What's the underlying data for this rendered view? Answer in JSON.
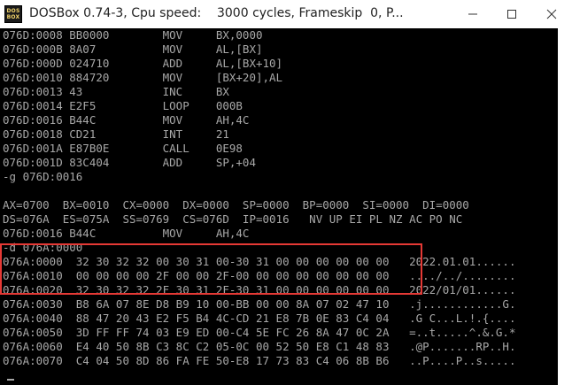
{
  "window": {
    "title": "DOSBox 0.74-3, Cpu speed:    3000 cycles, Frameskip  0, P...",
    "icon_line1": "DOS",
    "icon_line2": "BOX"
  },
  "console": {
    "lines": [
      "076D:0008 BB0000        MOV     BX,0000",
      "076D:000B 8A07          MOV     AL,[BX]",
      "076D:000D 024710        ADD     AL,[BX+10]",
      "076D:0010 884720        MOV     [BX+20],AL",
      "076D:0013 43            INC     BX",
      "076D:0014 E2F5          LOOP    000B",
      "076D:0016 B44C          MOV     AH,4C",
      "076D:0018 CD21          INT     21",
      "076D:001A E87B0E        CALL    0E98",
      "076D:001D 83C404        ADD     SP,+04",
      "-g 076D:0016",
      "",
      "AX=0700  BX=0010  CX=0000  DX=0000  SP=0000  BP=0000  SI=0000  DI=0000",
      "DS=076A  ES=075A  SS=0769  CS=076D  IP=0016   NV UP EI PL NZ AC PO NC",
      "076D:0016 B44C          MOV     AH,4C",
      "-d 076A:0000",
      "076A:0000  32 30 32 32 00 30 31 00-30 31 00 00 00 00 00 00   2022.01.01......",
      "076A:0010  00 00 00 00 2F 00 00 2F-00 00 00 00 00 00 00 00   ..../../........",
      "076A:0020  32 30 32 32 2F 30 31 2F-30 31 00 00 00 00 00 00   2022/01/01......",
      "076A:0030  B8 6A 07 8E D8 B9 10 00-BB 00 00 8A 07 02 47 10   .j............G.",
      "076A:0040  88 47 20 43 E2 F5 B4 4C-CD 21 E8 7B 0E 83 C4 04   .G C...L.!.{....",
      "076A:0050  3D FF FF 74 03 E9 ED 00-C4 5E FC 26 8A 47 0C 2A   =..t.....^.&.G.*",
      "076A:0060  E4 40 50 8B C3 8C C2 05-0C 00 52 50 E8 C1 48 83   .@P.......RP..H.",
      "076A:0070  C4 04 50 8D 86 FA FE 50-E8 17 73 83 C4 06 8B B6   ..P....P..s....."
    ]
  }
}
